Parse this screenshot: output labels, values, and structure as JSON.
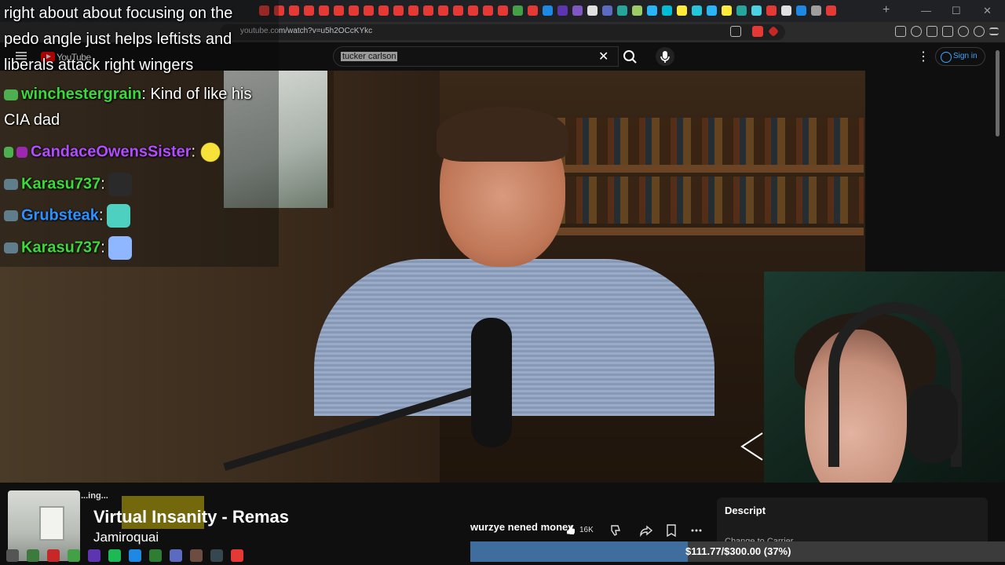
{
  "browser": {
    "url": "youtube.com/watch?v=u5h2OCcKYkc",
    "tab_colors": [
      "#e53935",
      "#e53935",
      "#e53935",
      "#e53935",
      "#e53935",
      "#e53935",
      "#e53935",
      "#e53935",
      "#e53935",
      "#e53935",
      "#e53935",
      "#e53935",
      "#e53935",
      "#e53935",
      "#e53935",
      "#e53935",
      "#e53935",
      "#43a047",
      "#e53935",
      "#1e88e5",
      "#5e35b1",
      "#7e57c2",
      "#e0e0e0",
      "#5c6bc0",
      "#26a69a",
      "#9ccc65",
      "#29b6f6",
      "#00bcd4",
      "#ffeb3b",
      "#26c6da",
      "#29b6f6",
      "#ffeb3b",
      "#26a69a",
      "#4dd0e1",
      "#e53935",
      "#e0e0e0",
      "#1e88e5",
      "#9e9e9e",
      "#e53935"
    ],
    "new_tab": "+",
    "minimize": "—",
    "maximize": "☐",
    "close": "✕"
  },
  "youtube": {
    "logo_text": "YouTube",
    "search_value": "tucker carlson",
    "search_clear": "✕",
    "more": "⋮",
    "sign_in": "Sign in"
  },
  "chat": {
    "messages": [
      {
        "text": "right about about focusing on the"
      },
      {
        "text": "pedo angle just helps leftists and"
      },
      {
        "text": "liberals attack right wingers"
      },
      {
        "user": "winchestergrain",
        "text": ": Kind of like his",
        "color": "#3cd83c"
      },
      {
        "text": "CIA dad"
      },
      {
        "user": "CandaceOwensSister",
        "text": ":",
        "color": "#b24dff"
      },
      {
        "user": "Karasu737",
        "text": ":",
        "color": "#3cd83c"
      },
      {
        "user": "Grubsteak",
        "text": ":",
        "color": "#2f8fff"
      },
      {
        "user": "Karasu737",
        "text": ":",
        "color": "#3cd83c"
      }
    ]
  },
  "now_playing": {
    "status": "...ing...",
    "title": "Virtual Insanity - Remas",
    "artist": "Jamiroquai"
  },
  "video": {
    "title_overlay": "wurzye nened money",
    "likes": "16K"
  },
  "description": {
    "title": "Descript",
    "sub": "Change to Carrier"
  },
  "donation": {
    "text": "$111.77/$300.00 (37%)",
    "progress": 0.37
  }
}
